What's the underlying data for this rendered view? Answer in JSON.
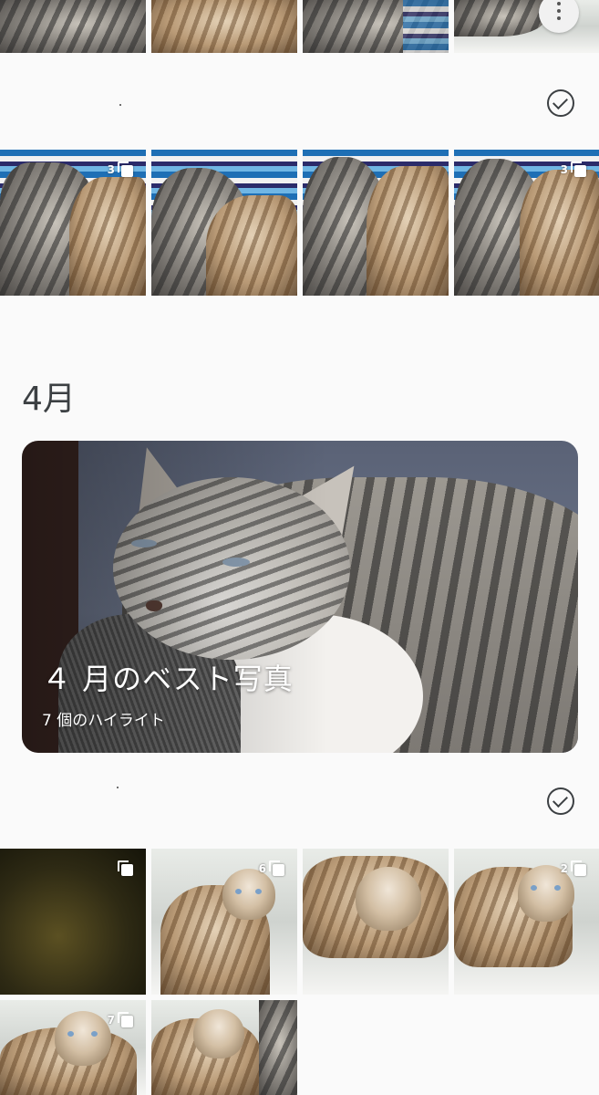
{
  "sections": [
    {
      "date_label": "",
      "photos": [
        {
          "multi_count": ""
        },
        {
          "multi_count": ""
        },
        {
          "multi_count": ""
        },
        {
          "multi_count": ""
        }
      ]
    },
    {
      "date_label": "",
      "photos": [
        {
          "multi_count": "3"
        },
        {
          "multi_count": ""
        },
        {
          "multi_count": ""
        },
        {
          "multi_count": "3"
        }
      ]
    }
  ],
  "month": {
    "heading": "4月",
    "highlight": {
      "title": "４ 月のベスト写真",
      "subtitle": "7 個のハイライト"
    },
    "grid": [
      {
        "multi_count": ""
      },
      {
        "multi_count": "6"
      },
      {
        "multi_count": ""
      },
      {
        "multi_count": "2"
      },
      {
        "multi_count": "7"
      },
      {
        "multi_count": ""
      }
    ]
  },
  "icons": {
    "more": "more-vert-icon",
    "select": "check-circle-icon",
    "stack": "photo-stack-icon"
  },
  "colors": {
    "background": "#fafafa",
    "icon": "#3c4043",
    "badge": "#ffffff"
  }
}
